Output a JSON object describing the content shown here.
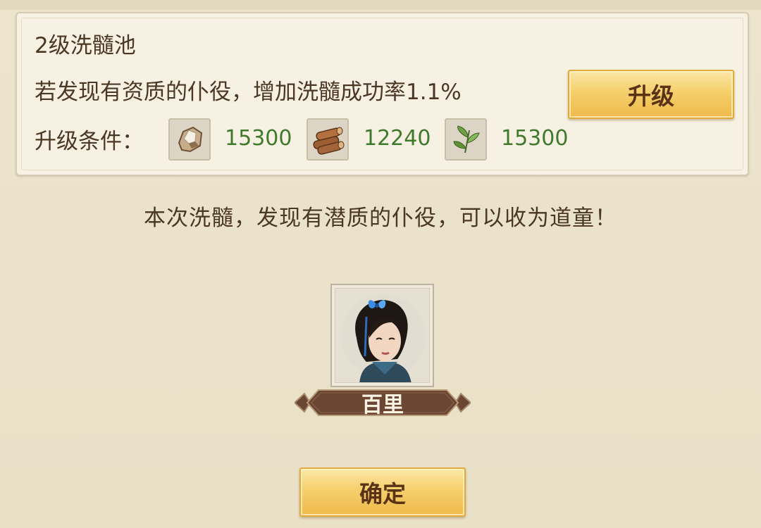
{
  "panel": {
    "title": "2级洗髓池",
    "description": "若发现有资质的仆役，增加洗髓成功率1.1%",
    "condition_label": "升级条件：",
    "upgrade_label": "升级",
    "resources": [
      {
        "icon": "stone-icon",
        "amount": "15300"
      },
      {
        "icon": "wood-logs-icon",
        "amount": "12240"
      },
      {
        "icon": "herb-leaf-icon",
        "amount": "15300"
      }
    ]
  },
  "notice": "本次洗髓，发现有潜质的仆役，可以收为道童！",
  "servant": {
    "name": "百里",
    "portrait": "servant-portrait"
  },
  "confirm_label": "确定",
  "colors": {
    "background": "#ebe3cc",
    "panel": "#f6f1e2",
    "text": "#4b3726",
    "amount": "#3f7a2c",
    "button_gold": "#f5cf6c",
    "banner": "#6b4733"
  }
}
